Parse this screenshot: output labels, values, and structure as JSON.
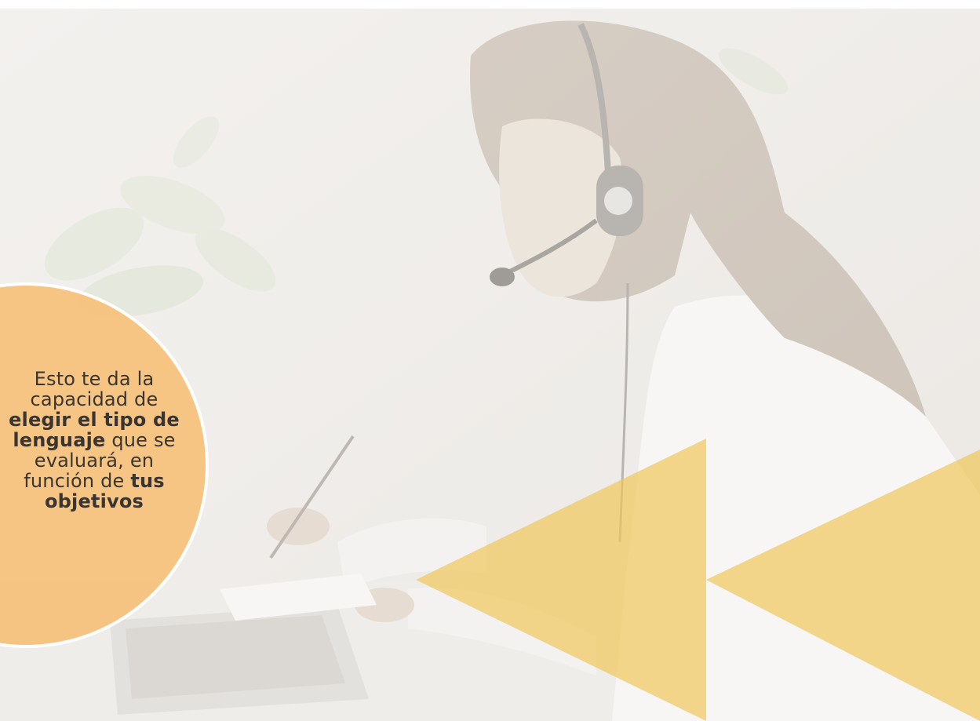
{
  "bubble": {
    "line1": "Esto te da la",
    "line2": "capacidad de",
    "line3_bold": "elegir el tipo de",
    "line4_bold": "lenguaje",
    "line4_rest": " que se",
    "line5": "evaluará, en",
    "line6_pre": "función de ",
    "line6_bold": "tus",
    "line7_bold": "objetivos"
  },
  "colors": {
    "bubble": "#f6c27e",
    "triangles": "#f0c75e",
    "text": "#3a3530"
  },
  "icons": [
    "fast-forward-arrows-icon"
  ]
}
